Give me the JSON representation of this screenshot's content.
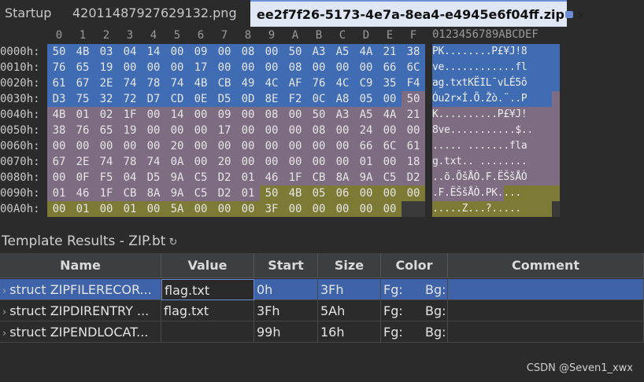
{
  "tabs": [
    {
      "label": "Startup"
    },
    {
      "label": "42011487927629132.png"
    },
    {
      "label": "ee2f7f26-5173-4e7a-8ea4-e4945e6f04ff.zip",
      "close": "×"
    }
  ],
  "hex": {
    "columns": [
      "0",
      "1",
      "2",
      "3",
      "4",
      "5",
      "6",
      "7",
      "8",
      "9",
      "A",
      "B",
      "C",
      "D",
      "E",
      "F"
    ],
    "ascii_header": "0123456789ABCDEF",
    "rows": [
      {
        "offset": "0000h:",
        "bytes": [
          "50",
          "4B",
          "03",
          "04",
          "14",
          "00",
          "09",
          "00",
          "08",
          "00",
          "50",
          "A3",
          "A5",
          "4A",
          "21",
          "38"
        ],
        "ascii": "PK........P£¥J!8"
      },
      {
        "offset": "0010h:",
        "bytes": [
          "76",
          "65",
          "19",
          "00",
          "00",
          "00",
          "17",
          "00",
          "00",
          "00",
          "08",
          "00",
          "00",
          "00",
          "66",
          "6C"
        ],
        "ascii": "ve............fl"
      },
      {
        "offset": "0020h:",
        "bytes": [
          "61",
          "67",
          "2E",
          "74",
          "78",
          "74",
          "4B",
          "CB",
          "49",
          "4C",
          "AF",
          "76",
          "4C",
          "C9",
          "35",
          "F4"
        ],
        "ascii": "ag.txtKËIL¯vLÉ5ô"
      },
      {
        "offset": "0030h:",
        "bytes": [
          "D3",
          "75",
          "32",
          "72",
          "D7",
          "CD",
          "0E",
          "D5",
          "0D",
          "8E",
          "F2",
          "0C",
          "A8",
          "05",
          "00",
          "50"
        ],
        "ascii": "Óu2r×Í.Õ.Žò.¨..P"
      },
      {
        "offset": "0040h:",
        "bytes": [
          "4B",
          "01",
          "02",
          "1F",
          "00",
          "14",
          "00",
          "09",
          "00",
          "08",
          "00",
          "50",
          "A3",
          "A5",
          "4A",
          "21"
        ],
        "ascii": "K..........P£¥J!"
      },
      {
        "offset": "0050h:",
        "bytes": [
          "38",
          "76",
          "65",
          "19",
          "00",
          "00",
          "00",
          "17",
          "00",
          "00",
          "00",
          "08",
          "00",
          "24",
          "00",
          "00"
        ],
        "ascii": "8ve...........$.."
      },
      {
        "offset": "0060h:",
        "bytes": [
          "00",
          "00",
          "00",
          "00",
          "00",
          "20",
          "00",
          "00",
          "00",
          "00",
          "00",
          "00",
          "00",
          "66",
          "6C",
          "61"
        ],
        "ascii": "..... .......fla"
      },
      {
        "offset": "0070h:",
        "bytes": [
          "67",
          "2E",
          "74",
          "78",
          "74",
          "0A",
          "00",
          "20",
          "00",
          "00",
          "00",
          "00",
          "00",
          "01",
          "00",
          "18"
        ],
        "ascii": "g.txt.. ........"
      },
      {
        "offset": "0080h:",
        "bytes": [
          "00",
          "0F",
          "F5",
          "04",
          "D5",
          "9A",
          "C5",
          "D2",
          "01",
          "46",
          "1F",
          "CB",
          "8A",
          "9A",
          "C5",
          "D2"
        ],
        "ascii": "..õ.ÕšÅÒ.F.ËŠšÅÒ"
      },
      {
        "offset": "0090h:",
        "bytes": [
          "01",
          "46",
          "1F",
          "CB",
          "8A",
          "9A",
          "C5",
          "D2",
          "01",
          "50",
          "4B",
          "05",
          "06",
          "00",
          "00",
          "00"
        ],
        "ascii": ".F.ËŠšÅÒ.PK...."
      },
      {
        "offset": "00A0h:",
        "bytes": [
          "00",
          "01",
          "00",
          "01",
          "00",
          "5A",
          "00",
          "00",
          "00",
          "3F",
          "00",
          "00",
          "00",
          "00",
          "00",
          ""
        ],
        "ascii": ".....Z...?....."
      }
    ],
    "region_colors": {
      "zipfilerecord": "#3f6cb3",
      "zipdirentry": "#7e6d82",
      "zipendlocator": "#7c7a34"
    }
  },
  "template": {
    "title": "Template Results - ZIP.bt",
    "refresh_glyph": "↻",
    "columns": [
      "Name",
      "Value",
      "Start",
      "Size",
      "Color",
      "Comment"
    ],
    "rows": [
      {
        "name": "struct ZIPFILERECOR...",
        "value": "flag.txt",
        "start": "0h",
        "size": "3Fh",
        "fg": "Fg:",
        "bg": "Bg:",
        "comment": "",
        "selected": true
      },
      {
        "name": "struct ZIPDIRENTRY ...",
        "value": "flag.txt",
        "start": "3Fh",
        "size": "5Ah",
        "fg": "Fg:",
        "bg": "Bg:",
        "comment": "",
        "selected": false
      },
      {
        "name": "struct ZIPENDLOCAT...",
        "value": "",
        "start": "99h",
        "size": "16h",
        "fg": "Fg:",
        "bg": "Bg:",
        "comment": "",
        "selected": false
      }
    ]
  },
  "watermark": "CSDN @Seven1_xwx"
}
